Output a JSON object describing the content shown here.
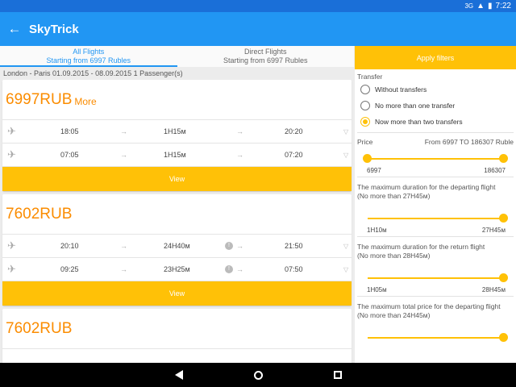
{
  "status": {
    "signal": "3G",
    "time": "7:22"
  },
  "appbar": {
    "back_icon": "arrow-left-icon",
    "title": "SkyTrick"
  },
  "tabs": [
    {
      "label": "All Flights",
      "sub": "Starting from 6997 Rubles",
      "active": true
    },
    {
      "label": "Direct Flights",
      "sub": "Starting from 6997 Rubles",
      "active": false
    }
  ],
  "summary": "London - Paris   01.09.2015 - 08.09.2015   1 Passenger(s)",
  "cards": [
    {
      "price": "6997RUB",
      "more": "More",
      "legs": [
        {
          "dep": "18:05",
          "dur": "1H15м",
          "arr": "20:20",
          "info": false
        },
        {
          "dep": "07:05",
          "dur": "1H15м",
          "arr": "07:20",
          "info": false
        }
      ],
      "view": "View"
    },
    {
      "price": "7602RUB",
      "more": "",
      "legs": [
        {
          "dep": "20:10",
          "dur": "24H40м",
          "arr": "21:50",
          "info": true
        },
        {
          "dep": "09:25",
          "dur": "23H25м",
          "arr": "07:50",
          "info": true
        }
      ],
      "view": "View"
    },
    {
      "price": "7602RUB",
      "more": "",
      "legs": [],
      "view": ""
    }
  ],
  "filters": {
    "apply": "Apply filters",
    "transfer_title": "Transfer",
    "transfer_options": [
      {
        "label": "Without transfers",
        "selected": false
      },
      {
        "label": "No more than one transfer",
        "selected": false
      },
      {
        "label": "Now more than two transfers",
        "selected": true
      }
    ],
    "price": {
      "title": "Price",
      "range_text": "From 6997 TO 186307 Ruble",
      "min": "6997",
      "max": "186307"
    },
    "dep_duration": {
      "title": "The maximum duration for the departing flight",
      "sub": "(No more than 27H45м)",
      "min": "1H10м",
      "max": "27H45м"
    },
    "ret_duration": {
      "title": "The maximum duration for the return flight",
      "sub": "(No more than 28H45м)",
      "min": "1H05м",
      "max": "28H45м"
    },
    "total_price": {
      "title": "The maximum total price for the departing flight",
      "sub": "(No more than 24H45м)"
    }
  },
  "colors": {
    "primary": "#2196f3",
    "status": "#1a6fd8",
    "accent": "#ffc107",
    "price": "#fb8c00"
  }
}
